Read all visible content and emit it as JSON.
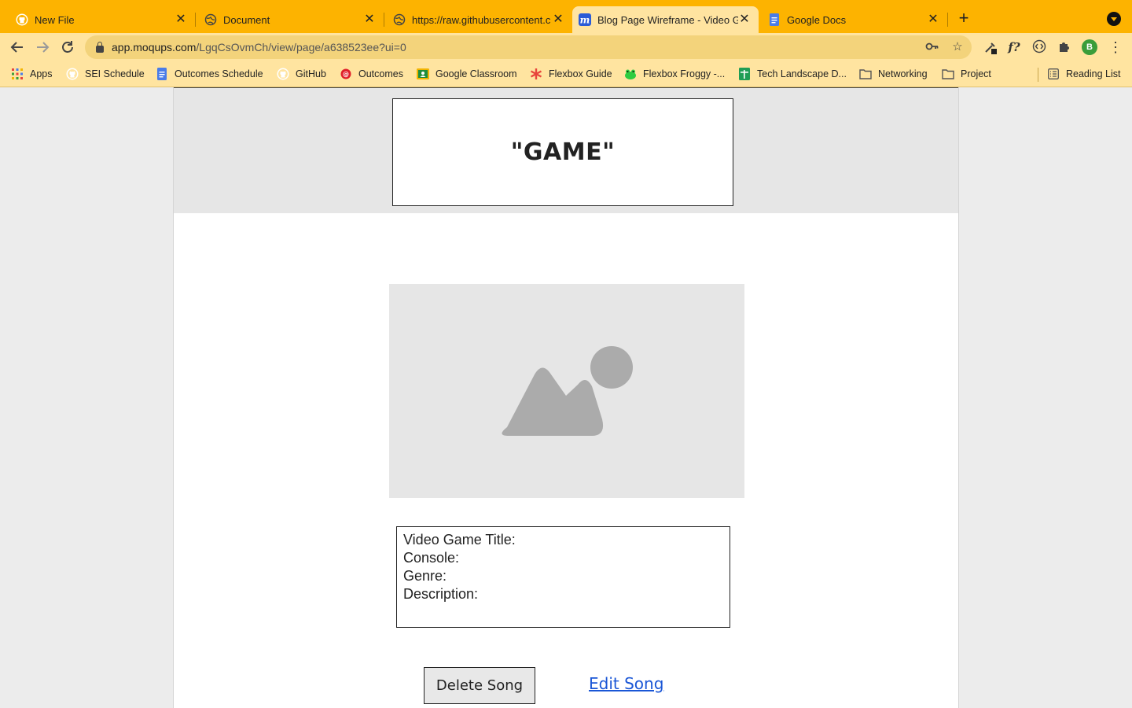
{
  "browser": {
    "tabs": [
      {
        "title": "New File",
        "icon": "github-icon",
        "active": false
      },
      {
        "title": "Document",
        "icon": "globe-icon",
        "active": false
      },
      {
        "title": "https://raw.githubusercontent.c",
        "icon": "globe-icon",
        "active": false
      },
      {
        "title": "Blog Page Wireframe - Video G",
        "icon": "moqups-icon",
        "active": true
      },
      {
        "title": "Google Docs",
        "icon": "docs-icon",
        "active": false
      }
    ],
    "new_tab_label": "+",
    "url_host": "app.moqups.com",
    "url_path": "/LgqCsOvmCh/view/page/a638523ee?ui=0",
    "profile_initial": "B",
    "bookmarks": [
      {
        "label": "Apps",
        "icon": "apps-grid-icon"
      },
      {
        "label": "SEI Schedule",
        "icon": "github-icon"
      },
      {
        "label": "Outcomes Schedule",
        "icon": "docs-icon"
      },
      {
        "label": "GitHub",
        "icon": "github-icon"
      },
      {
        "label": "Outcomes",
        "icon": "outcomes-icon"
      },
      {
        "label": "Google Classroom",
        "icon": "classroom-icon"
      },
      {
        "label": "Flexbox Guide",
        "icon": "asterisk-icon"
      },
      {
        "label": "Flexbox Froggy -...",
        "icon": "frog-icon"
      },
      {
        "label": "Tech Landscape D...",
        "icon": "sheets-icon"
      },
      {
        "label": "Networking",
        "icon": "folder-icon"
      },
      {
        "label": "Project",
        "icon": "folder-icon"
      }
    ],
    "reading_list": "Reading List",
    "colors": {
      "tab_strip": "#fdb300",
      "toolbar": "#ffe4a0",
      "link": "#1a56d6"
    }
  },
  "page": {
    "title": "\"GAME\"",
    "image_placeholder": "image-placeholder-icon",
    "info": {
      "title_label": "Video Game Title:",
      "console_label": "Console:",
      "genre_label": "Genre:",
      "description_label": "Description:"
    },
    "delete_button": "Delete Song",
    "edit_link": "Edit Song"
  }
}
